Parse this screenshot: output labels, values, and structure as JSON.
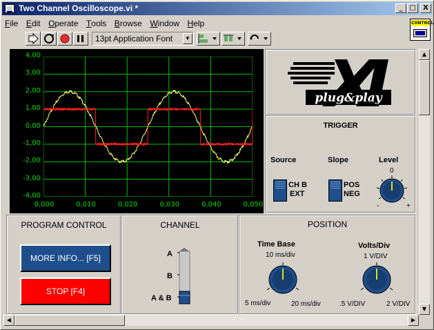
{
  "window": {
    "title": "Two Channel Oscilloscope.vi *",
    "minimize": "_",
    "maximize": "□",
    "close": "X"
  },
  "menu": [
    {
      "pre": "",
      "key": "F",
      "post": "ile"
    },
    {
      "pre": "",
      "key": "E",
      "post": "dit"
    },
    {
      "pre": "",
      "key": "O",
      "post": "perate"
    },
    {
      "pre": "",
      "key": "T",
      "post": "ools"
    },
    {
      "pre": "",
      "key": "B",
      "post": "rowse"
    },
    {
      "pre": "",
      "key": "W",
      "post": "indow"
    },
    {
      "pre": "",
      "key": "H",
      "post": "elp"
    }
  ],
  "control_icon_label": "CONTROL",
  "toolbar": {
    "font": "13pt Application Font"
  },
  "graph": {
    "y_ticks": [
      "4,00",
      "3,00",
      "2,00",
      "1,00",
      "0,00",
      "-1,00",
      "-2,00",
      "-3,00",
      "-4,00"
    ],
    "x_ticks": [
      "0,000",
      "0,010",
      "0,020",
      "0,030",
      "0,040",
      "0,050"
    ],
    "ylim": [
      -4,
      4
    ],
    "xlim": [
      0,
      0.05
    ],
    "sine": {
      "color": "#ffff66",
      "amplitude": 2,
      "period": 0.025
    },
    "square": {
      "color": "#ff2020",
      "amplitude": 1,
      "period": 0.025
    },
    "grid_color": "#00c000"
  },
  "logo": {
    "word": "plug&play"
  },
  "trigger": {
    "title": "TRIGGER",
    "source_label": "Source",
    "source_opt1": "CH B",
    "source_opt2": "EXT",
    "slope_label": "Slope",
    "slope_opt1": "POS",
    "slope_opt2": "NEG",
    "level_label": "Level",
    "level_zero": "0",
    "level_minus": "-",
    "level_plus": "+"
  },
  "program_control": {
    "title": "PROGRAM CONTROL",
    "more_info": "MORE INFO... [F5]",
    "stop": "STOP [F4]"
  },
  "channel": {
    "title": "CHANNEL",
    "opt_a": "A",
    "opt_b": "B",
    "opt_ab": "A & B",
    "selected": "A & B"
  },
  "position": {
    "title": "POSITION",
    "timebase_label": "Time Base",
    "timebase_value": "10 ms/div",
    "timebase_min": "5 ms/div",
    "timebase_max": "20 ms/div",
    "volts_label": "Volts/Div",
    "volts_value": "1 V/DIV",
    "volts_min": ".5 V/DIV",
    "volts_max": "2 V/DIV"
  }
}
